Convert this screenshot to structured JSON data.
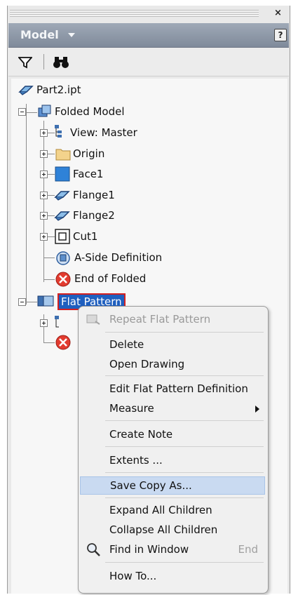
{
  "panel": {
    "title": "Model",
    "help_label": "?",
    "close_label": "×"
  },
  "toolbar": {
    "filter_icon": "filter-icon",
    "find_icon": "binoculars-icon"
  },
  "tree": {
    "root": "Part2.ipt",
    "folded_model": "Folded Model",
    "children": [
      {
        "label": "View: Master",
        "icon": "view-icon"
      },
      {
        "label": "Origin",
        "icon": "folder-icon"
      },
      {
        "label": "Face1",
        "icon": "face-icon"
      },
      {
        "label": "Flange1",
        "icon": "flange-icon"
      },
      {
        "label": "Flange2",
        "icon": "flange-icon"
      },
      {
        "label": "Cut1",
        "icon": "cut-icon"
      },
      {
        "label": "A-Side Definition",
        "icon": "aside-icon"
      },
      {
        "label": "End of Folded",
        "icon": "end-of-part-icon"
      }
    ],
    "flat_pattern": "Flat Pattern"
  },
  "context_menu": {
    "items": [
      {
        "label": "Repeat Flat Pattern",
        "disabled": true
      },
      {
        "label": "Delete"
      },
      {
        "label": "Open Drawing"
      },
      {
        "label": "Edit Flat Pattern Definition"
      },
      {
        "label": "Measure",
        "submenu": true
      },
      {
        "label": "Create Note"
      },
      {
        "label": "Extents ..."
      },
      {
        "label": "Save Copy As...",
        "highlighted": true
      },
      {
        "label": "Expand All Children"
      },
      {
        "label": "Collapse All Children"
      },
      {
        "label": "Find in Window",
        "shortcut": "End"
      },
      {
        "label": "How To..."
      }
    ]
  },
  "colors": {
    "titlebar": "#8f99a8",
    "selection": "#1f5fbf",
    "menu_highlight": "#c9daf1",
    "end_marker": "#e23b2f"
  }
}
